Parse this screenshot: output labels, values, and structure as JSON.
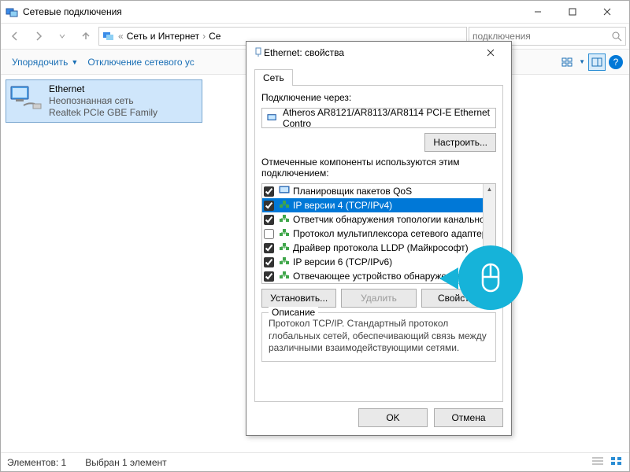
{
  "main_window": {
    "title": "Сетевые подключения",
    "breadcrumb": {
      "seg1": "Сеть и Интернет",
      "seg2": "Се"
    },
    "search_placeholder": "подключения",
    "commandbar": {
      "organize": "Упорядочить",
      "disable": "Отключение сетевого ус"
    },
    "connection": {
      "name": "Ethernet",
      "status": "Неопознанная сеть",
      "adapter": "Realtek PCIe GBE Family"
    },
    "statusbar": {
      "count": "Элементов: 1",
      "selected": "Выбран 1 элемент"
    }
  },
  "dialog": {
    "title": "Ethernet: свойства",
    "tab": "Сеть",
    "connect_via_label": "Подключение через:",
    "adapter": "Atheros AR8121/AR8113/AR8114 PCI-E Ethernet Contro",
    "configure_btn": "Настроить...",
    "components_label": "Отмеченные компоненты используются этим подключением:",
    "components": [
      {
        "checked": true,
        "label": "Планировщик пакетов QoS",
        "selected": false
      },
      {
        "checked": true,
        "label": "IP версии 4 (TCP/IPv4)",
        "selected": true
      },
      {
        "checked": true,
        "label": "Ответчик обнаружения топологии канального уров",
        "selected": false
      },
      {
        "checked": false,
        "label": "Протокол мультиплексора сетевого адаптера (Ма",
        "selected": false
      },
      {
        "checked": true,
        "label": "Драйвер протокола LLDP (Майкрософт)",
        "selected": false
      },
      {
        "checked": true,
        "label": "IP версии 6 (TCP/IPv6)",
        "selected": false
      },
      {
        "checked": true,
        "label": "Отвечающее устройство обнаружения топологии к",
        "selected": false
      }
    ],
    "install_btn": "Установить...",
    "remove_btn": "Удалить",
    "props_btn": "Свойства",
    "desc_legend": "Описание",
    "desc_text": "Протокол TCP/IP. Стандартный протокол глобальных сетей, обеспечивающий связь между различными взаимодействующими сетями.",
    "ok_btn": "OK",
    "cancel_btn": "Отмена"
  }
}
